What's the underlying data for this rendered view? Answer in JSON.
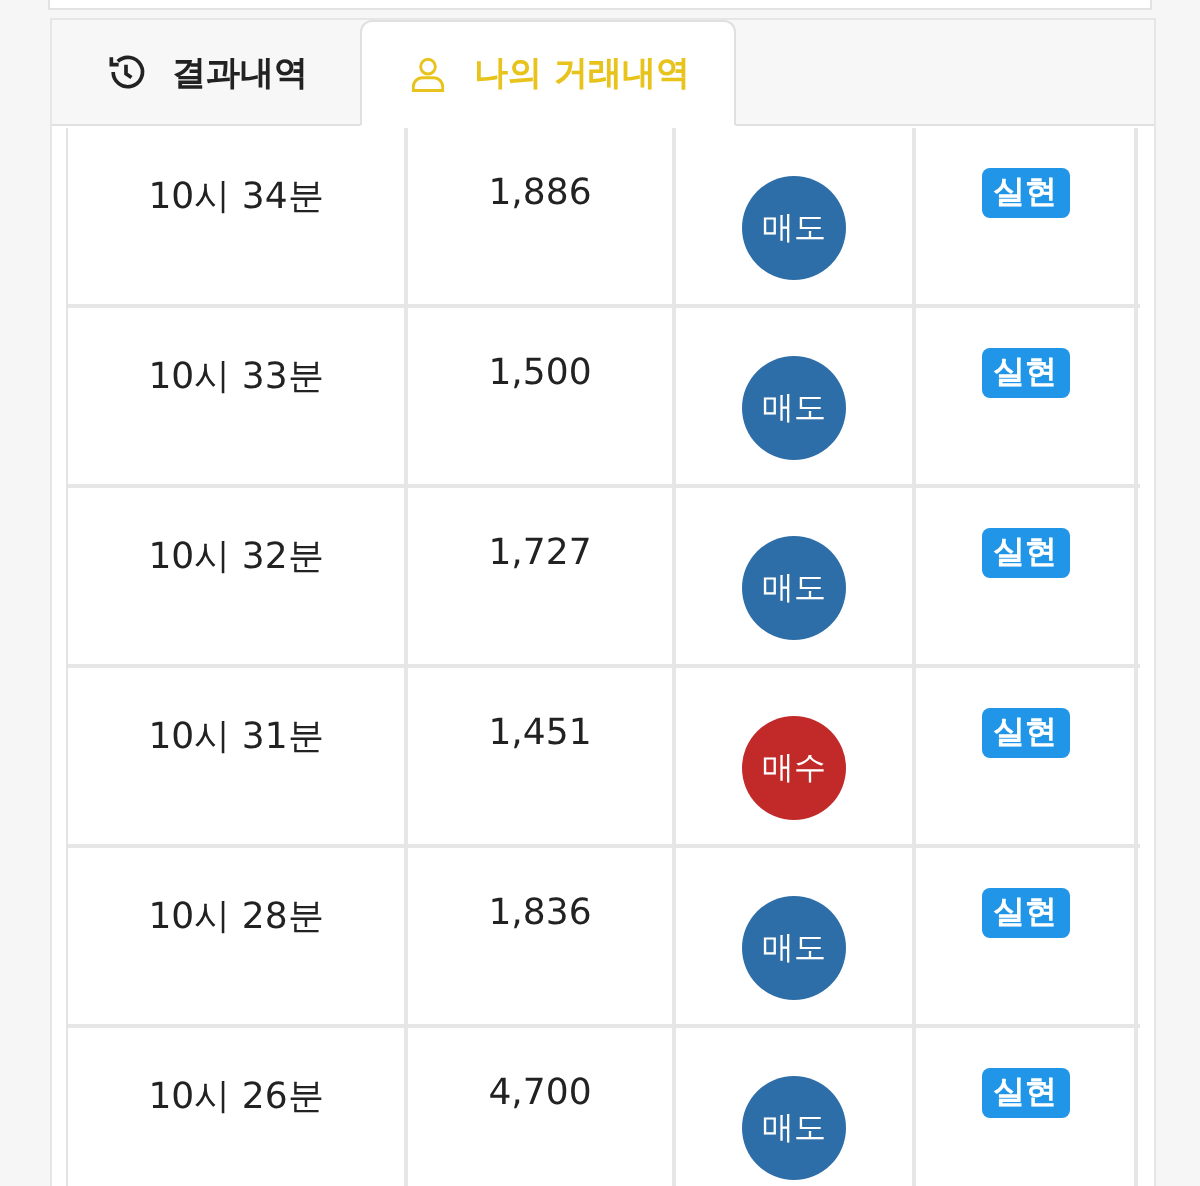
{
  "tabs": [
    {
      "label": "결과내역",
      "kind": "history",
      "selected": false
    },
    {
      "label": "나의 거래내역",
      "kind": "user",
      "selected": true
    }
  ],
  "rows": [
    {
      "time": "10시 34분",
      "price": "1,886",
      "side": {
        "label": "매도",
        "kind": "sell"
      },
      "status": "실현"
    },
    {
      "time": "10시 33분",
      "price": "1,500",
      "side": {
        "label": "매도",
        "kind": "sell"
      },
      "status": "실현"
    },
    {
      "time": "10시 32분",
      "price": "1,727",
      "side": {
        "label": "매도",
        "kind": "sell"
      },
      "status": "실현"
    },
    {
      "time": "10시 31분",
      "price": "1,451",
      "side": {
        "label": "매수",
        "kind": "buy"
      },
      "status": "실현"
    },
    {
      "time": "10시 28분",
      "price": "1,836",
      "side": {
        "label": "매도",
        "kind": "sell"
      },
      "status": "실현"
    },
    {
      "time": "10시 26분",
      "price": "4,700",
      "side": {
        "label": "매도",
        "kind": "sell"
      },
      "status": "실현"
    }
  ]
}
